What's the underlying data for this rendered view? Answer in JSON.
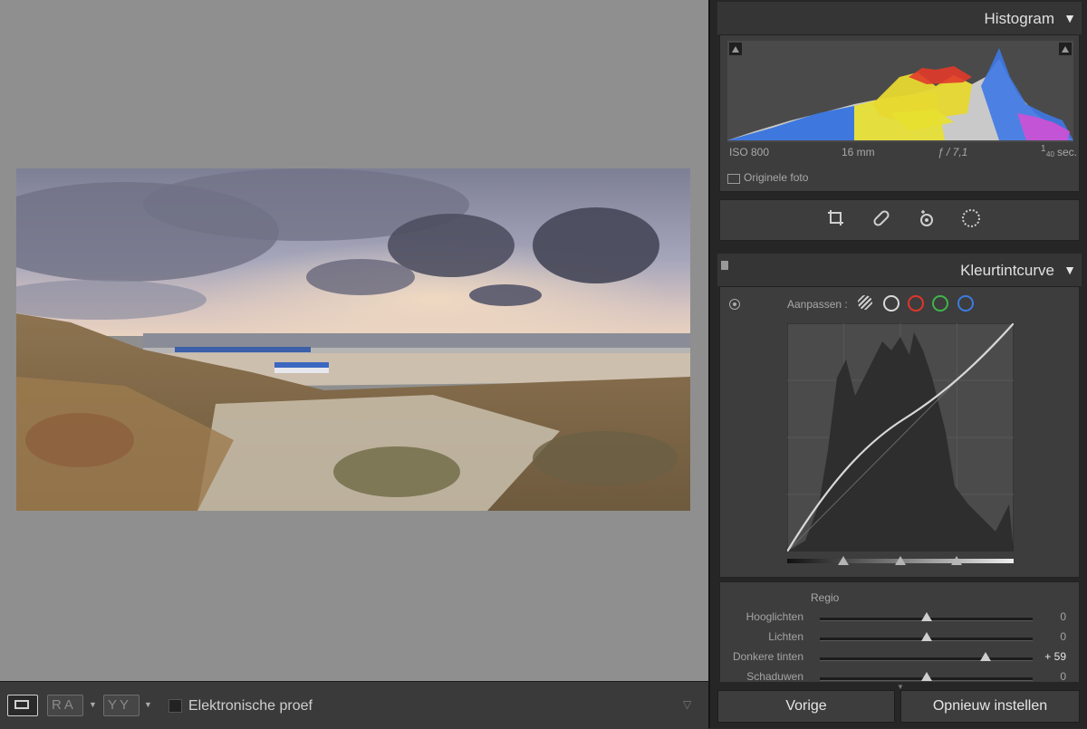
{
  "toolbar": {
    "view_icon": "loupe-view-icon",
    "ra_label": "RA",
    "yy_label": "YY",
    "softproof_label": "Elektronische proef"
  },
  "histogram": {
    "title": "Histogram",
    "iso": "ISO 800",
    "focal": "16 mm",
    "aperture": "ƒ / 7,1",
    "shutter_num": "1",
    "shutter_den": "40",
    "shutter_unit": "sec.",
    "original_label": "Originele foto"
  },
  "tools": [
    "crop-icon",
    "healing-icon",
    "redeye-icon",
    "mask-icon"
  ],
  "tonecurve": {
    "title": "Kleurtintcurve",
    "adjust_label": "Aanpassen :",
    "channels": [
      {
        "name": "parametric",
        "color": "#bdbdbd"
      },
      {
        "name": "rgb",
        "color": "#d9d9d9"
      },
      {
        "name": "red",
        "color": "#e0352b"
      },
      {
        "name": "green",
        "color": "#3fb54a"
      },
      {
        "name": "blue",
        "color": "#3d7be0"
      }
    ],
    "region_title": "Regio",
    "sliders": [
      {
        "label": "Hooglichten",
        "value": "0",
        "level": 0.5
      },
      {
        "label": "Lichten",
        "value": "0",
        "level": 0.5
      },
      {
        "label": "Donkere tinten",
        "value": "+ 59",
        "level": 0.78
      },
      {
        "label": "Schaduwen",
        "value": "0",
        "level": 0.5
      }
    ]
  },
  "buttons": {
    "previous": "Vorige",
    "reset": "Opnieuw instellen"
  }
}
